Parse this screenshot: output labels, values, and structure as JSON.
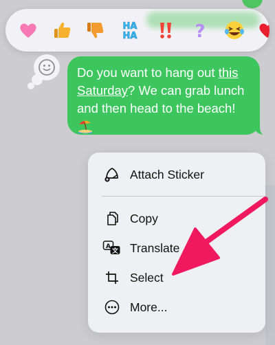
{
  "tapbacks": [
    {
      "name": "heart",
      "icon": "pink-heart-icon"
    },
    {
      "name": "thumbs-up",
      "icon": "thumbs-up-icon"
    },
    {
      "name": "thumbs-down",
      "icon": "thumbs-down-icon"
    },
    {
      "name": "haha",
      "icon": "haha-icon",
      "text_top": "HA",
      "text_bottom": "HA"
    },
    {
      "name": "exclamation",
      "icon": "double-exclamation-icon",
      "text": "‼"
    },
    {
      "name": "question",
      "icon": "question-mark-icon",
      "text": "?"
    },
    {
      "name": "laugh",
      "icon": "laughing-face-icon"
    },
    {
      "name": "red-heart",
      "icon": "red-heart-icon"
    }
  ],
  "message": {
    "text_before_link": "Do you want to hang out ",
    "link_text": "this Saturday",
    "text_after_link": "? We can grab lunch and then head to the beach! ",
    "emoji": "🏝",
    "emoji_icon": "beach-umbrella-icon"
  },
  "emoji_button": {
    "icon": "smiley-face-icon"
  },
  "context_menu": {
    "items": [
      {
        "label": "Attach Sticker",
        "icon": "sticker-icon"
      },
      {
        "label": "Copy",
        "icon": "copy-icon"
      },
      {
        "label": "Translate",
        "icon": "translate-icon"
      },
      {
        "label": "Select",
        "icon": "crop-select-icon"
      },
      {
        "label": "More...",
        "icon": "ellipsis-circle-icon"
      }
    ]
  },
  "annotation": {
    "icon": "pointing-arrow-icon",
    "color": "#f0195f"
  },
  "colors": {
    "bubble_green": "#3dc55e",
    "background": "#ccccd1",
    "menu_background": "#eff0f3"
  }
}
